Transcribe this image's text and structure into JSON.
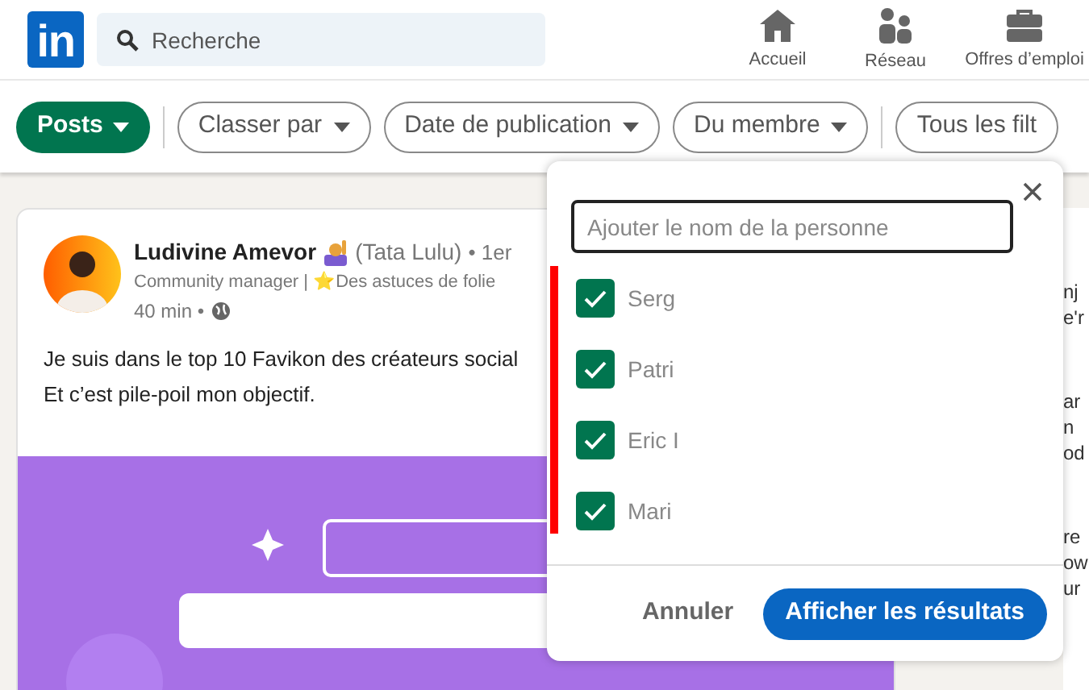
{
  "header": {
    "logo": "in",
    "search": {
      "placeholder": "Recherche"
    },
    "nav": [
      {
        "label": "Accueil",
        "kind": "home"
      },
      {
        "label": "Réseau",
        "kind": "network"
      },
      {
        "label": "Offres d’emploi",
        "kind": "jobs"
      }
    ]
  },
  "filters": [
    {
      "label": "Posts",
      "selected": true
    },
    {
      "label": "Classer par",
      "selected": false
    },
    {
      "label": "Date de publication",
      "selected": false
    },
    {
      "label": "Du membre",
      "selected": false
    },
    {
      "label": "Tous les filt",
      "selected": false
    }
  ],
  "post": {
    "author": "Ludivine Amevor",
    "nickname": "(Tata Lulu)",
    "degree": "• 1er",
    "headline": "Community manager | ⭐Des astuces de folie",
    "time": "40 min •",
    "text": [
      "Je suis dans le top 10 Favikon des créateurs social",
      "Et c’est pile-poil mon objectif."
    ],
    "image": {
      "kind": "picture"
    }
  },
  "side_fragments": [
    "nj",
    "e'r",
    "ar",
    "n",
    "od",
    "re",
    "ow",
    "ur"
  ],
  "popup": {
    "search": {
      "placeholder": "Ajouter le nom de la personne"
    },
    "members": [
      {
        "name": "Serg",
        "checked": true
      },
      {
        "name": "Patri",
        "checked": true
      },
      {
        "name": "Eric I",
        "checked": true
      },
      {
        "name": "Mari",
        "checked": true
      }
    ],
    "cancel": "Annuler",
    "submit": "Afficher les résultats"
  }
}
